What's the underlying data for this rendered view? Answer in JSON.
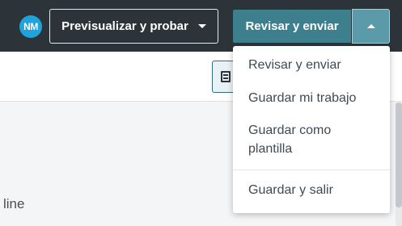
{
  "header": {
    "avatar_initials": "NM",
    "preview_button_label": "Previsualizar y probar",
    "review_button_label": "Revisar y enviar"
  },
  "dropdown": {
    "items": [
      {
        "label": "Revisar y enviar"
      },
      {
        "label": "Guardar mi trabajo"
      },
      {
        "label": "Guardar como plantilla"
      },
      {
        "label": "Guardar y salir"
      }
    ]
  },
  "content": {
    "partial_text": "line"
  },
  "icons": {
    "preview_caret": "chevron-down-icon",
    "toggle_caret": "chevron-up-icon",
    "doc_icon": "document-icon"
  },
  "colors": {
    "topbar_bg": "#2d3439",
    "avatar_bg": "#1ea3dd",
    "review_button_bg": "#3d7f8d",
    "toggle_button_bg": "#5b9aa9"
  }
}
